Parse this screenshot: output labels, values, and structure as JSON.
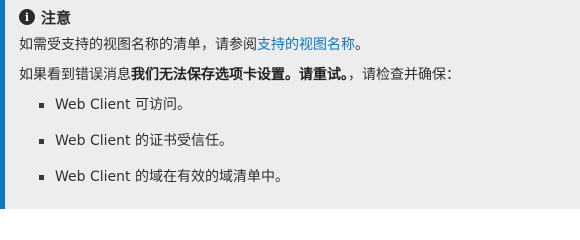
{
  "note": {
    "title": "注意",
    "line1_prefix": "如需受支持的视图名称的清单，请参阅",
    "line1_link": "支持的视图名称",
    "line1_suffix": "。",
    "line2_prefix": "如果看到错误消息",
    "line2_bold": "我们无法保存选项卡设置。请重试。",
    "line2_suffix": "，请检查并确保：",
    "items": [
      "Web Client 可访问。",
      "Web Client 的证书受信任。",
      "Web Client 的域在有效的域清单中。"
    ]
  },
  "colors": {
    "accent": "#0b79bf",
    "background": "#ededed"
  }
}
